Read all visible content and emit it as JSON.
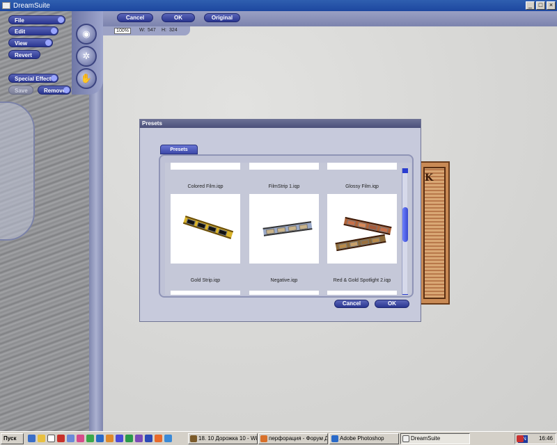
{
  "window": {
    "title": "DreamSuite"
  },
  "menu": {
    "file": "File",
    "edit": "Edit",
    "view": "View",
    "revert": "Revert",
    "special_effects": "Special Effects",
    "save": "Save",
    "remove": "Remove"
  },
  "toolbar": {
    "cancel": "Cancel",
    "ok": "OK",
    "original": "Original"
  },
  "info": {
    "zoom": "100%",
    "width_label": "W:",
    "width": "547",
    "height_label": "H:",
    "height": "324"
  },
  "dialog": {
    "title": "Presets",
    "tab": "Presets",
    "presets": [
      "Colored Film.iqp",
      "FilmStrip 1.iqp",
      "Glossy Film.iqp",
      "Gold Strip.iqp",
      "Negative.iqp",
      "Red & Gold Spotlight 2.iqp"
    ],
    "cancel": "Cancel",
    "ok": "OK"
  },
  "document": {
    "visible_letter": "K"
  },
  "taskbar": {
    "start": "Пуск",
    "tasks": [
      "18. 10 Дорожка 10 - Wi...",
      "перфорация - Форум Д...",
      "Adobe Photoshop",
      "DreamSuite"
    ],
    "language": "EN",
    "clock": "16:46"
  },
  "colors": {
    "accent": "#2a3690",
    "panel": "#9aa0c4",
    "titlebar": "#1d47a0"
  }
}
